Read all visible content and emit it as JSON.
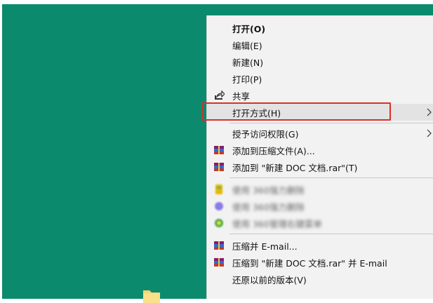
{
  "menu": {
    "items": [
      {
        "id": "open",
        "label": "打开(O)"
      },
      {
        "id": "edit",
        "label": "编辑(E)"
      },
      {
        "id": "new",
        "label": "新建(N)"
      },
      {
        "id": "print",
        "label": "打印(P)"
      },
      {
        "id": "share",
        "label": "共享"
      },
      {
        "id": "open_with",
        "label": "打开方式(H)"
      },
      {
        "id": "grant_access",
        "label": "授予访问权限(G)"
      },
      {
        "id": "add_archive",
        "label": "添加到压缩文件(A)..."
      },
      {
        "id": "add_rar",
        "label": "添加到 \"新建 DOC 文档.rar\"(T)"
      },
      {
        "id": "blurred1",
        "label": "使用 360强力删除"
      },
      {
        "id": "blurred2",
        "label": "使用 360强力删除"
      },
      {
        "id": "blurred3",
        "label": "使用 360管理右键菜单"
      },
      {
        "id": "zip_email",
        "label": "压缩并 E-mail..."
      },
      {
        "id": "zip_rar_email",
        "label": "压缩到 \"新建 DOC 文档.rar\" 并 E-mail"
      },
      {
        "id": "restore",
        "label": "还原以前的版本(V)"
      }
    ]
  },
  "colors": {
    "desktop": "#0b8a6e",
    "menu_bg": "#f2f2f2",
    "highlight_border": "#d9302b"
  }
}
